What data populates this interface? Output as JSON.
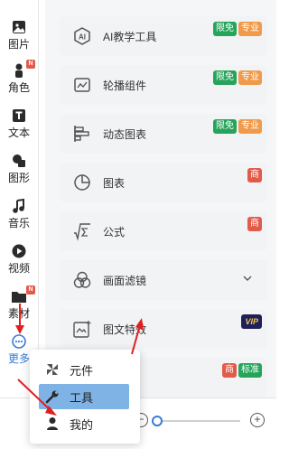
{
  "sidebar": {
    "items": [
      {
        "label": "图片",
        "icon": "image-icon",
        "new": false
      },
      {
        "label": "角色",
        "icon": "person-icon",
        "new": true,
        "new_text": "N"
      },
      {
        "label": "文本",
        "icon": "text-icon",
        "new": false
      },
      {
        "label": "图形",
        "icon": "shape-icon",
        "new": false
      },
      {
        "label": "音乐",
        "icon": "music-icon",
        "new": false
      },
      {
        "label": "视频",
        "icon": "play-icon",
        "new": false
      },
      {
        "label": "素材",
        "icon": "folder-icon",
        "new": true,
        "new_text": "N"
      },
      {
        "label": "更多",
        "icon": "more-icon",
        "new": false,
        "active": true
      }
    ]
  },
  "cards": [
    {
      "label": "AI教学工具",
      "icon": "ai-icon",
      "badges": [
        {
          "text": "限免",
          "color": "green"
        },
        {
          "text": "专业",
          "color": "orange"
        }
      ]
    },
    {
      "label": "轮播组件",
      "icon": "carousel-icon",
      "badges": [
        {
          "text": "限免",
          "color": "green"
        },
        {
          "text": "专业",
          "color": "orange"
        }
      ]
    },
    {
      "label": "动态图表",
      "icon": "dynamic-chart-icon",
      "badges": [
        {
          "text": "限免",
          "color": "green"
        },
        {
          "text": "专业",
          "color": "orange"
        }
      ]
    },
    {
      "label": "图表",
      "icon": "pie-chart-icon",
      "badges": [
        {
          "text": "商",
          "color": "red"
        }
      ]
    },
    {
      "label": "公式",
      "icon": "formula-icon",
      "badges": [
        {
          "text": "商",
          "color": "red"
        }
      ]
    },
    {
      "label": "画面滤镜",
      "icon": "filter-icon",
      "badges": [],
      "expandable": true
    },
    {
      "label": "图文特效",
      "icon": "image-effect-icon",
      "badges": [
        {
          "text": "VIP",
          "color": "vip"
        }
      ]
    },
    {
      "label": "",
      "icon": "",
      "badges": [
        {
          "text": "商",
          "color": "red"
        },
        {
          "text": "标准",
          "color": "green"
        }
      ]
    }
  ],
  "popup_menu": {
    "items": [
      {
        "label": "元件",
        "icon": "pinwheel-icon",
        "active": false
      },
      {
        "label": "工具",
        "icon": "wrench-icon",
        "active": true
      },
      {
        "label": "我的",
        "icon": "user-icon",
        "active": false
      }
    ]
  },
  "zoom": {
    "minus": "−",
    "plus": "+"
  },
  "colors": {
    "badge_green": "#27a45b",
    "badge_orange": "#f09a4a",
    "badge_red": "#e25b4a",
    "badge_vip_bg": "#1f1f5a",
    "menu_active": "#7fb3e6",
    "accent_blue": "#3a7bd5",
    "annotation_red": "#e02020"
  }
}
